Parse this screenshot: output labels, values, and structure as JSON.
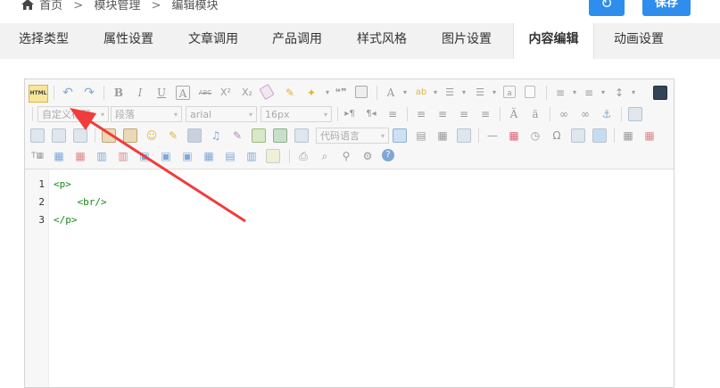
{
  "breadcrumb": {
    "home": "首页",
    "sep": ">",
    "module_mgmt": "模块管理",
    "edit_module": "编辑模块"
  },
  "actions": {
    "refresh_icon": "↻",
    "save_label": "保存"
  },
  "tabs": [
    {
      "label": "选择类型",
      "active": false
    },
    {
      "label": "属性设置",
      "active": false
    },
    {
      "label": "文章调用",
      "active": false
    },
    {
      "label": "产品调用",
      "active": false
    },
    {
      "label": "样式风格",
      "active": false
    },
    {
      "label": "图片设置",
      "active": false
    },
    {
      "label": "内容编辑",
      "active": true
    },
    {
      "label": "动画设置",
      "active": false
    }
  ],
  "editor": {
    "html_button": "HTML",
    "selects": {
      "heading": "自定义标题",
      "paragraph": "段落",
      "font": "arial",
      "size": "16px",
      "code_lang": "代码语言"
    },
    "toolbar_glyphs": {
      "undo": "↶",
      "redo": "↷",
      "bold": "B",
      "italic": "I",
      "underline": "U",
      "border": "A",
      "strike": "ABC",
      "superscript": "X²",
      "subscript": "X₂",
      "quote": "❝❞",
      "font_color": "A",
      "emoji": "☺",
      "special_char": "Ω",
      "help": "?"
    },
    "lines": [
      "1",
      "2",
      "3"
    ],
    "code": [
      "<p>",
      "    <br/>",
      "</p>"
    ]
  },
  "colors": {
    "accent": "#2e8ded",
    "arrow": "#f03c3c",
    "code_green": "#1a8a1a"
  }
}
